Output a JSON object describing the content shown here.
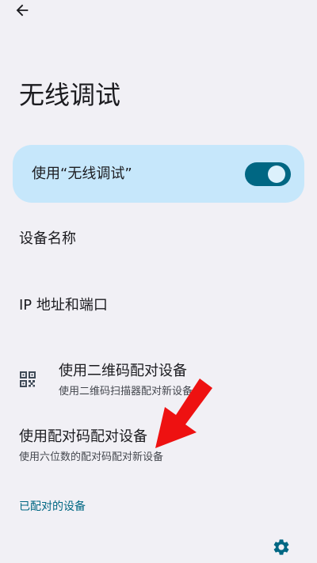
{
  "header": {
    "back_icon": "arrow-back-icon"
  },
  "page": {
    "title": "无线调试"
  },
  "main_switch": {
    "label": "使用“无线调试”",
    "state": "on",
    "track_color": "#006783",
    "card_color": "#c6e7fb"
  },
  "rows": {
    "device_name": {
      "label": "设备名称"
    },
    "ip_port": {
      "label": "IP 地址和端口"
    },
    "qr_pair": {
      "icon": "qr-code-icon",
      "label": "使用二维码配对设备",
      "summary": "使用二维码扫描器配对新设备"
    },
    "code_pair": {
      "label": "使用配对码配对设备",
      "summary": "使用六位数的配对码配对新设备"
    }
  },
  "paired_section": {
    "header": "已配对的设备",
    "accent_color": "#006783"
  },
  "footer": {
    "settings_icon": "gear-icon"
  },
  "annotation": {
    "arrow_color": "#ee1111"
  }
}
